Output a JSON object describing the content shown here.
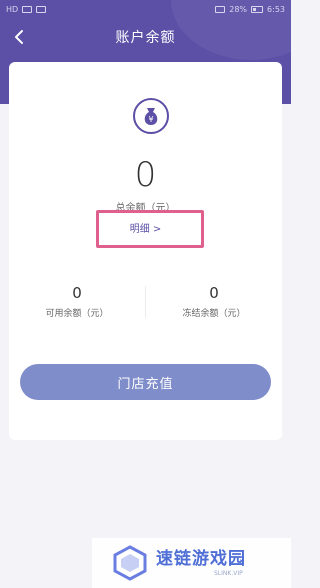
{
  "status_bar": {
    "left": "HD",
    "battery": "28%",
    "time": "6:53"
  },
  "nav": {
    "title": "账户余额"
  },
  "balance": {
    "total_amount": "0",
    "total_label": "总余额（元）",
    "detail_label": "明细 >"
  },
  "available": {
    "amount": "0",
    "label": "可用余额（元）"
  },
  "frozen": {
    "amount": "0",
    "label": "冻结余额（元）"
  },
  "actions": {
    "recharge_label": "门店充值"
  },
  "watermark": {
    "name": "速链游戏园",
    "url": "SLINK.VIP"
  },
  "colors": {
    "brand": "#5b4fa6",
    "button": "#7f8dcb",
    "highlight": "#e0608d"
  }
}
